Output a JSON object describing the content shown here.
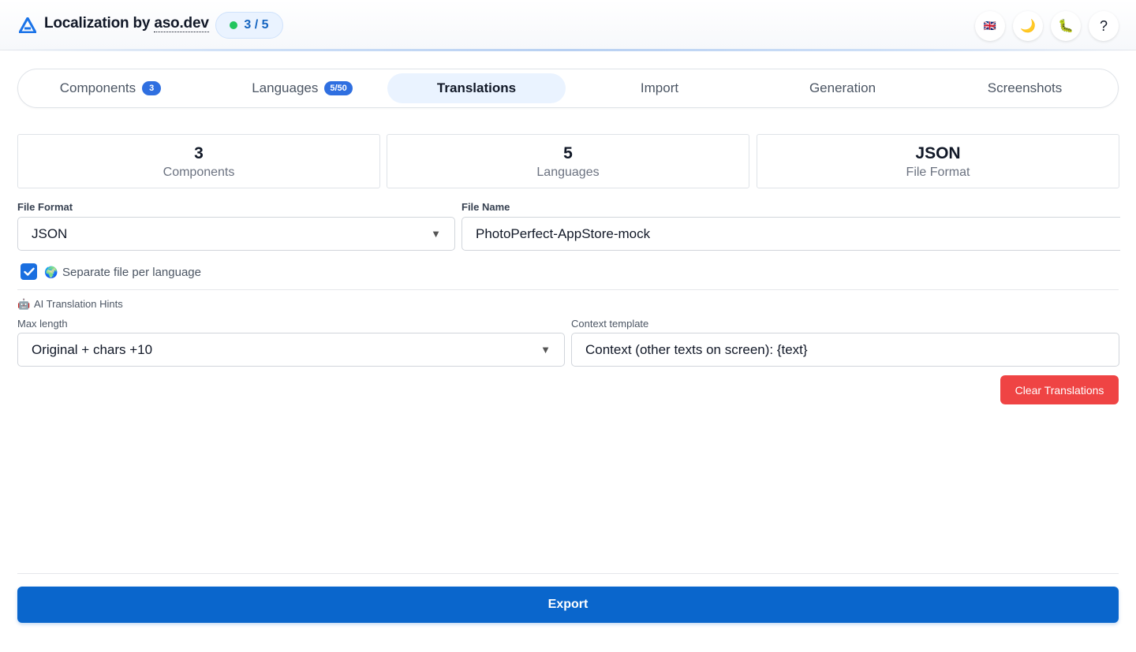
{
  "header": {
    "title_prefix": "Localization by ",
    "title_brand": "aso.dev",
    "progress": "3 / 5",
    "language_flag": "🇬🇧",
    "theme_icon": "🌙",
    "bug_icon": "🐛",
    "help_label": "?"
  },
  "tabs": [
    {
      "label": "Components",
      "badge": "3"
    },
    {
      "label": "Languages",
      "badge": "5/50"
    },
    {
      "label": "Translations"
    },
    {
      "label": "Import"
    },
    {
      "label": "Generation"
    },
    {
      "label": "Screenshots"
    }
  ],
  "stats": [
    {
      "value": "3",
      "label": "Components"
    },
    {
      "value": "5",
      "label": "Languages"
    },
    {
      "value": "JSON",
      "label": "File Format"
    }
  ],
  "form": {
    "file_format_label": "File Format",
    "file_format_value": "JSON",
    "file_name_label": "File Name",
    "file_name_value": "PhotoPerfect-AppStore-mock",
    "separate_file_label": "Separate file per language",
    "separate_file_checked": true,
    "globe_icon": "🌍",
    "ai_hints_icon": "🤖",
    "ai_hints_title": "AI Translation Hints",
    "max_length_label": "Max length",
    "max_length_value": "Original + chars +10",
    "context_label": "Context template",
    "context_value": "Context (other texts on screen): {text}"
  },
  "actions": {
    "clear_label": "Clear Translations",
    "export_label": "Export"
  },
  "colors": {
    "accent": "#0a66cc",
    "danger": "#ef4444",
    "badge": "#2f6fe0",
    "active_tab_bg": "#eaf3ff",
    "status_dot": "#22c55e"
  }
}
